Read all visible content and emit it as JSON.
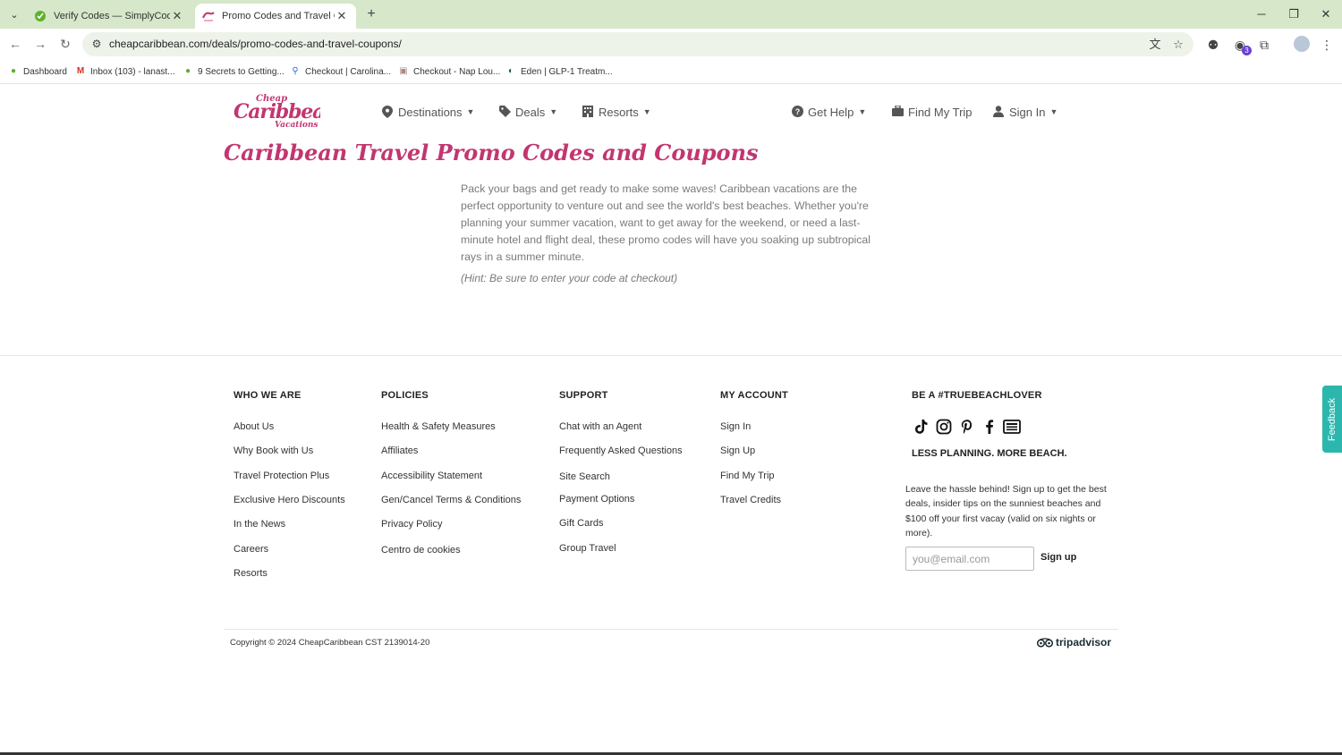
{
  "browser": {
    "tabs": [
      {
        "title": "Verify Codes — SimplyCodes",
        "active": false
      },
      {
        "title": "Promo Codes and Travel Coupo",
        "active": true
      }
    ],
    "url": "cheapcaribbean.com/deals/promo-codes-and-travel-coupons/",
    "extension_badge": "3",
    "bookmarks": [
      {
        "label": "Dashboard",
        "icon": "simplycodes-icon"
      },
      {
        "label": "Inbox (103) - lanast...",
        "icon": "gmail-icon"
      },
      {
        "label": "9 Secrets to Getting...",
        "icon": "simplycodes-icon"
      },
      {
        "label": "Checkout | Carolina...",
        "icon": "store-icon"
      },
      {
        "label": "Checkout - Nap Lou...",
        "icon": "page-icon"
      },
      {
        "label": "Eden | GLP-1 Treatm...",
        "icon": "eden-icon"
      }
    ]
  },
  "site": {
    "logo": {
      "line1": "Cheap",
      "line2": "Caribbean",
      "line3": "Vacations"
    },
    "nav": {
      "destinations": "Destinations",
      "deals": "Deals",
      "resorts": "Resorts",
      "get_help": "Get Help",
      "find_my_trip": "Find My Trip",
      "sign_in": "Sign In"
    },
    "page_title": "Caribbean Travel Promo Codes and Coupons",
    "intro": "Pack your bags and get ready to make some waves! Caribbean vacations are the perfect opportunity to venture out and see the world's best beaches. Whether you're planning your summer vacation, want to get away for the weekend, or need a last-minute hotel and flight deal, these promo codes will have you soaking up subtropical rays in a summer minute.",
    "hint": "(Hint: Be sure to enter your code at checkout)"
  },
  "footer": {
    "who_we_are": {
      "title": "WHO WE ARE",
      "links": [
        "About Us",
        "Why Book with Us",
        "Travel Protection Plus",
        "Exclusive Hero Discounts",
        "In the News",
        "Careers",
        "Resorts"
      ]
    },
    "policies": {
      "title": "POLICIES",
      "links": [
        "Health & Safety Measures",
        "Affiliates",
        "Accessibility Statement",
        "Gen/Cancel Terms & Conditions",
        "Privacy Policy",
        "Centro de cookies"
      ]
    },
    "support": {
      "title": "SUPPORT",
      "links": [
        "Chat with an Agent",
        "Frequently Asked Questions",
        "Site Search",
        "Payment Options",
        "Gift Cards",
        "Group Travel"
      ]
    },
    "my_account": {
      "title": "MY ACCOUNT",
      "links": [
        "Sign In",
        "Sign Up",
        "Find My Trip",
        "Travel Credits"
      ]
    },
    "social": {
      "title": "BE A #TRUEBEACHLOVER",
      "icons": [
        "tiktok-icon",
        "instagram-icon",
        "pinterest-icon",
        "facebook-icon",
        "blog-icon"
      ],
      "tagline": "LESS PLANNING. MORE BEACH.",
      "newsletter": "Leave the hassle behind! Sign up to get the best deals, insider tips on the sunniest beaches and $100 off your first vacay (valid on six nights or more).",
      "email_placeholder": "you@email.com",
      "signup_label": "Sign up"
    },
    "copyright": "Copyright © 2024 CheapCaribbean CST 2139014-20",
    "tripadvisor": "tripadvisor"
  },
  "feedback_label": "Feedback",
  "colors": {
    "brand_pink": "#c23670",
    "chrome_green": "#d7e7c9",
    "feedback_teal": "#2bb7ad"
  }
}
